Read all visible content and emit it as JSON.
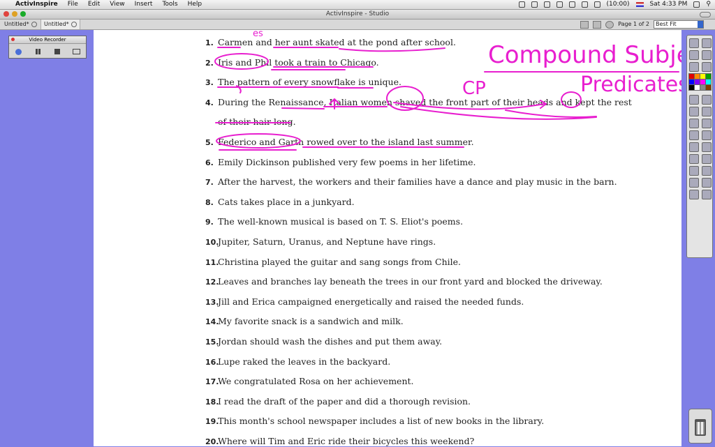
{
  "menubar": {
    "apple_glyph": "",
    "app_name": "ActivInspire",
    "menus": [
      "File",
      "Edit",
      "View",
      "Insert",
      "Tools",
      "Help"
    ],
    "battery": "(10:00)",
    "clock": "Sat 4:33 PM"
  },
  "window": {
    "title": "ActivInspire - Studio"
  },
  "tabs": [
    {
      "label": "Untitled*"
    },
    {
      "label": "Untitled*"
    }
  ],
  "toolbar": {
    "page_indicator": "Page 1 of 2",
    "zoom_value": "Best Fit"
  },
  "recorder": {
    "title": "Video Recorder"
  },
  "document": {
    "lines": [
      {
        "num": "1.",
        "text": "Carmen and her aunt skated at the pond after school."
      },
      {
        "num": "2.",
        "text": "Iris and Phil took a train to Chicago."
      },
      {
        "num": "3.",
        "text": "The pattern of every snowflake is unique."
      },
      {
        "num": "4.",
        "text": "During the Renaissance, Italian women shaved the front part of their heads and kept the rest"
      },
      {
        "num": "",
        "text": "of their hair long."
      },
      {
        "num": "5.",
        "text": "Federico and Garth rowed over to the island last summer."
      },
      {
        "num": "6.",
        "text": "Emily Dickinson published very few poems in her lifetime."
      },
      {
        "num": "7.",
        "text": "After the harvest, the workers and their families have a dance and play music in the barn."
      },
      {
        "num": "8.",
        "text": "Cats takes place in a junkyard."
      },
      {
        "num": "9.",
        "text": "The well-known musical is based on T. S. Eliot's poems."
      },
      {
        "num": "10.",
        "text": "Jupiter, Saturn, Uranus, and Neptune have rings."
      },
      {
        "num": "11.",
        "text": "Christina played the guitar and sang songs from Chile."
      },
      {
        "num": "12.",
        "text": "Leaves and branches lay beneath the trees in our front yard and blocked the driveway."
      },
      {
        "num": "13.",
        "text": "Jill and Erica campaigned energetically and raised the needed funds."
      },
      {
        "num": "14.",
        "text": "My favorite snack is a sandwich and milk."
      },
      {
        "num": "15.",
        "text": "Jordan should wash the dishes and put them away."
      },
      {
        "num": "16.",
        "text": "Lupe raked the leaves in the backyard."
      },
      {
        "num": "17.",
        "text": "We congratulated Rosa on her achievement."
      },
      {
        "num": "18.",
        "text": "I read the draft of the paper and did a thorough revision."
      },
      {
        "num": "19.",
        "text": "This month's school newspaper includes a list of new books in the library."
      },
      {
        "num": "20.",
        "text": "Where will Tim and Eric ride their bicycles this weekend?"
      }
    ]
  },
  "annotations": {
    "heading_1": "Compound Subjects",
    "heading_2": "Predicates",
    "mark_cp": "CP",
    "mark_es": "es",
    "ink_color": "#e81ecf"
  },
  "colors": {
    "background": "#7f7fe6",
    "page": "#ffffff"
  },
  "toolbox": {
    "palette": [
      "#e00000",
      "#ff8c00",
      "#ffff00",
      "#00a000",
      "#0000ff",
      "#8000ff",
      "#ff00ff",
      "#00ffff",
      "#000000",
      "#ffffff",
      "#888888",
      "#804000"
    ]
  },
  "icons": {
    "trash": "trash-icon"
  }
}
